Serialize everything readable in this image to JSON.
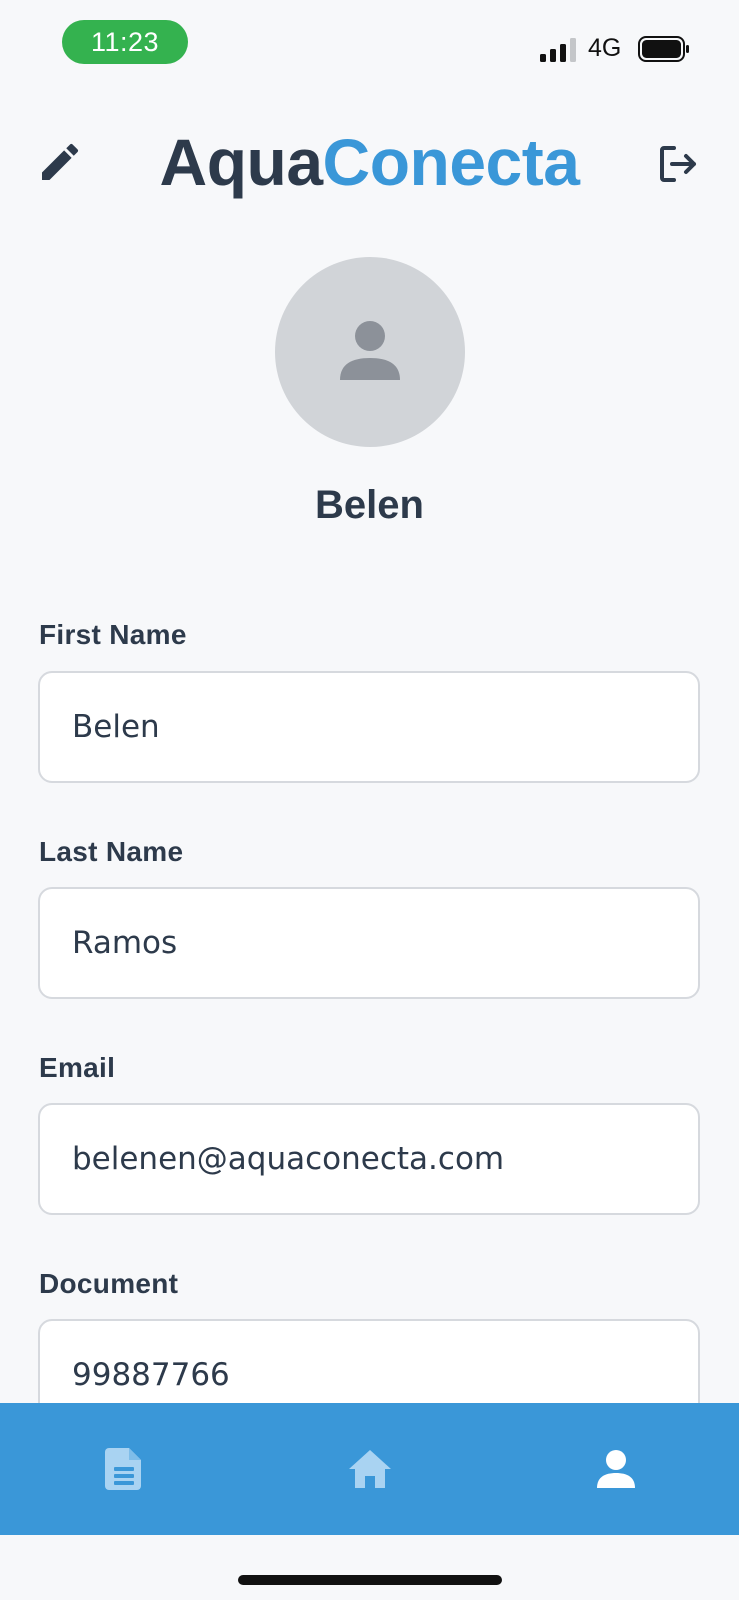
{
  "status_bar": {
    "time": "11:23",
    "network": "4G"
  },
  "header": {
    "logo_part1": "Aqua",
    "logo_part2": "Conecta",
    "edit_icon": "pencil-icon",
    "logout_icon": "logout-icon"
  },
  "profile": {
    "name": "Belen",
    "avatar_icon": "user-icon"
  },
  "form": {
    "first_name": {
      "label": "First Name",
      "value": "Belen"
    },
    "last_name": {
      "label": "Last Name",
      "value": "Ramos"
    },
    "email": {
      "label": "Email",
      "value": "belenen@aquaconecta.com"
    },
    "document": {
      "label": "Document",
      "value": "99887766"
    }
  },
  "bottom_nav": {
    "items": [
      {
        "icon": "document-icon",
        "active": false
      },
      {
        "icon": "home-icon",
        "active": false
      },
      {
        "icon": "user-icon",
        "active": true
      }
    ]
  },
  "colors": {
    "accent": "#3a97d8",
    "text": "#2d3a4b",
    "background": "#f7f8fa",
    "time_pill": "#34b24f"
  }
}
